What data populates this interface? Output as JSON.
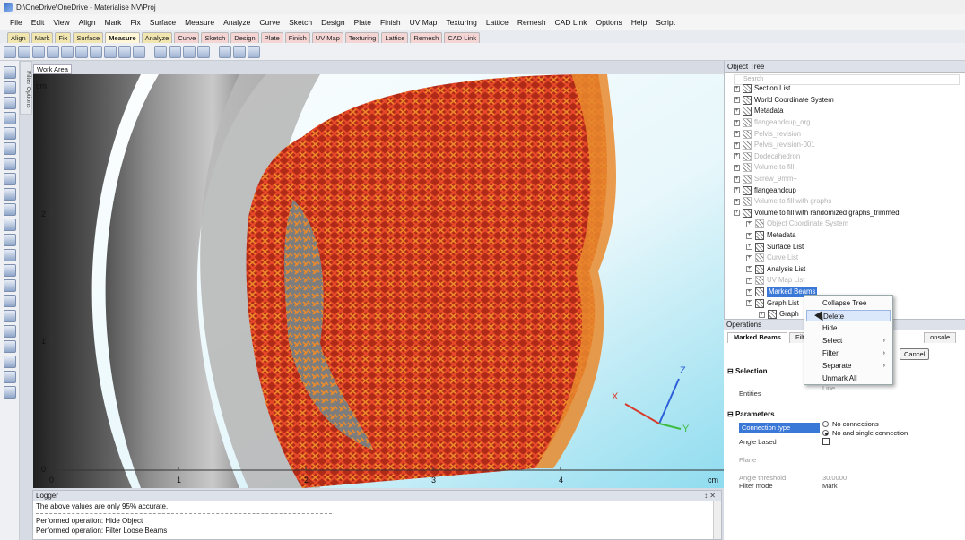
{
  "window": {
    "title": "D:\\OneDrive\\OneDrive - Materialise NV\\Proj"
  },
  "menu": [
    "File",
    "Edit",
    "View",
    "Align",
    "Mark",
    "Fix",
    "Surface",
    "Measure",
    "Analyze",
    "Curve",
    "Sketch",
    "Design",
    "Plate",
    "Finish",
    "UV Map",
    "Texturing",
    "Lattice",
    "Remesh",
    "CAD Link",
    "Options",
    "Help",
    "Script"
  ],
  "tabs": [
    {
      "label": "Align",
      "style": "yellow"
    },
    {
      "label": "Mark",
      "style": "yellow"
    },
    {
      "label": "Fix",
      "style": "yellow"
    },
    {
      "label": "Surface",
      "style": "yellow"
    },
    {
      "label": "Measure",
      "style": "active"
    },
    {
      "label": "Analyze",
      "style": "yellow"
    },
    {
      "label": "Curve",
      "style": "pink"
    },
    {
      "label": "Sketch",
      "style": "pink"
    },
    {
      "label": "Design",
      "style": "pink"
    },
    {
      "label": "Plate",
      "style": "pink"
    },
    {
      "label": "Finish",
      "style": "pink"
    },
    {
      "label": "UV Map",
      "style": "pink"
    },
    {
      "label": "Texturing",
      "style": "pink"
    },
    {
      "label": "Lattice",
      "style": "pink"
    },
    {
      "label": "Remesh",
      "style": "pink"
    },
    {
      "label": "CAD Link",
      "style": "pink"
    }
  ],
  "left_panel": {
    "filter_options": "Filter Options"
  },
  "workarea": {
    "tab": "Work Area",
    "unit_label": "cm",
    "y_ticks": [
      "2",
      "1",
      "0"
    ],
    "x_ticks": [
      "0",
      "1",
      "2",
      "3",
      "4"
    ],
    "x_unit": "cm",
    "axis_labels": {
      "x": "X",
      "y": "Y",
      "z": "Z"
    },
    "axis_colors": {
      "x": "#d83b2a",
      "y": "#3dbb3d",
      "z": "#2d5fd8"
    }
  },
  "logger": {
    "title": "Logger",
    "controls": "↕ ✕",
    "lines": [
      "The above values are only 95% accurate.",
      "Performed operation: Hide Object",
      "Performed operation: Filter Loose Beams"
    ]
  },
  "object_tree": {
    "title": "Object Tree",
    "search_placeholder": "Search",
    "items": [
      {
        "label": "Section List",
        "dim": false,
        "indent": 0
      },
      {
        "label": "World Coordinate System",
        "dim": false,
        "indent": 0
      },
      {
        "label": "Metadata",
        "dim": false,
        "indent": 0
      },
      {
        "label": "flangeandcup_org",
        "dim": true,
        "indent": 0
      },
      {
        "label": "Pelvis_revision",
        "dim": true,
        "indent": 0
      },
      {
        "label": "Pelvis_revision-001",
        "dim": true,
        "indent": 0
      },
      {
        "label": "Dodecahedron",
        "dim": true,
        "indent": 0
      },
      {
        "label": "Volume to fill",
        "dim": true,
        "indent": 0
      },
      {
        "label": "Screw_9mm+",
        "dim": true,
        "indent": 0
      },
      {
        "label": "flangeandcup",
        "dim": false,
        "indent": 0
      },
      {
        "label": "Volume to fill with graphs",
        "dim": true,
        "indent": 0
      },
      {
        "label": "Volume to fill with randomized graphs_trimmed",
        "dim": false,
        "indent": 0
      },
      {
        "label": "Object Coordinate System",
        "dim": true,
        "indent": 1
      },
      {
        "label": "Metadata",
        "dim": false,
        "indent": 1
      },
      {
        "label": "Surface List",
        "dim": false,
        "indent": 1
      },
      {
        "label": "Curve List",
        "dim": true,
        "indent": 1
      },
      {
        "label": "Analysis List",
        "dim": false,
        "indent": 1
      },
      {
        "label": "UV Map List",
        "dim": true,
        "indent": 1
      },
      {
        "label": "Marked Beams",
        "dim": false,
        "indent": 1,
        "selected": true
      },
      {
        "label": "Graph List",
        "dim": false,
        "indent": 1
      },
      {
        "label": "Graph",
        "dim": false,
        "indent": 2
      }
    ]
  },
  "context_menu": {
    "items": [
      {
        "label": "Collapse Tree",
        "submenu": false
      },
      {
        "label": "Delete",
        "submenu": false,
        "highlight": true
      },
      {
        "label": "Hide",
        "submenu": false
      },
      {
        "label": "Select",
        "submenu": true
      },
      {
        "label": "Filter",
        "submenu": true
      },
      {
        "label": "Separate",
        "submenu": true
      },
      {
        "label": "Unmark All",
        "submenu": false
      }
    ]
  },
  "operations": {
    "title": "Operations",
    "tabs": [
      "Marked Beams",
      "Filte",
      "onsole"
    ],
    "buttons": {
      "cancel": "Cancel"
    },
    "selection_header": "Selection",
    "entities_label": "Entities",
    "entities_value": "Line",
    "parameters_header": "Parameters",
    "connection_type_label": "Connection type",
    "connection_options": [
      "No connections",
      "No and single connection"
    ],
    "angle_based_label": "Angle based",
    "plane_label": "Plane",
    "angle_threshold_label": "Angle threshold",
    "angle_threshold_value": "30.0000",
    "filter_mode_label": "Filter mode",
    "filter_mode_value": "Mark"
  }
}
